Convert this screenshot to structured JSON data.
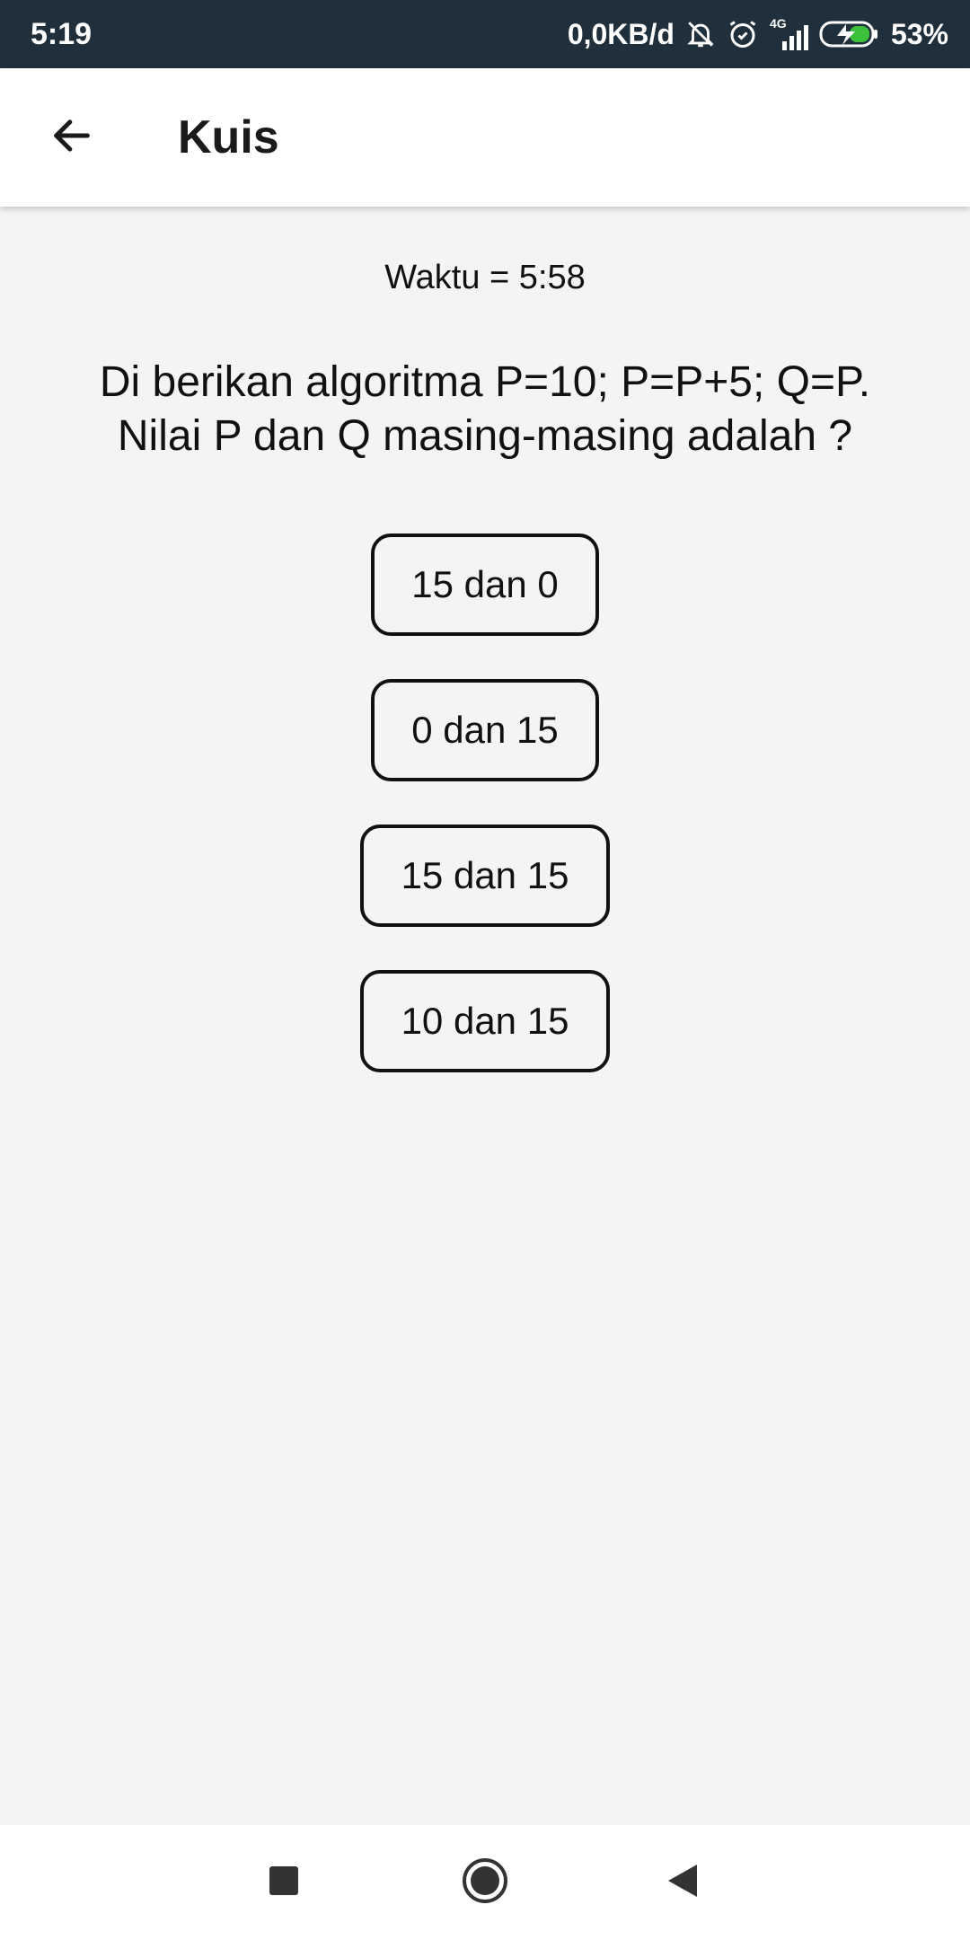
{
  "status_bar": {
    "time": "5:19",
    "network_speed": "0,0KB/d",
    "network_type": "4G",
    "battery": "53%",
    "icons": [
      "bell-off-icon",
      "alarm-icon",
      "signal-icon",
      "battery-charging-icon"
    ]
  },
  "app_bar": {
    "title": "Kuis",
    "back_icon": "arrow-left-icon"
  },
  "quiz": {
    "timer": "Waktu = 5:58",
    "question_line1": "Di berikan algoritma P=10; P=P+5; Q=P.",
    "question_line2": "Nilai P dan Q masing-masing adalah  ?",
    "options": [
      {
        "label": "15 dan 0"
      },
      {
        "label": "0 dan 15"
      },
      {
        "label": "15 dan 15"
      },
      {
        "label": "10 dan 15"
      }
    ]
  },
  "nav_bar": {
    "icons": [
      "recents-icon",
      "home-icon",
      "back-icon"
    ]
  },
  "colors": {
    "status_bar_bg": "#1f2f3b",
    "app_bar_bg": "#ffffff",
    "page_bg": "#f3f4f6",
    "battery_green": "#3cc13c"
  }
}
